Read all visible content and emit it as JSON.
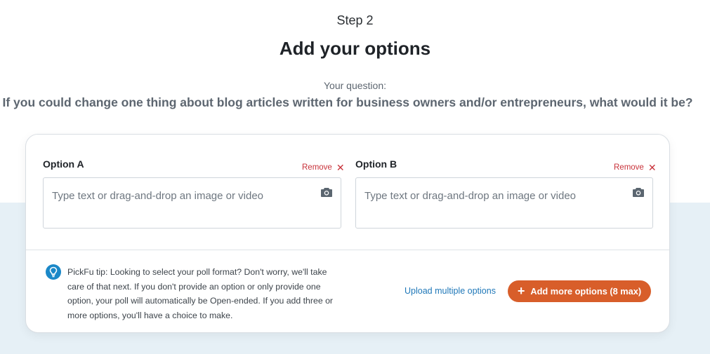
{
  "header": {
    "step": "Step 2",
    "title": "Add your options",
    "question_label": "Your question:",
    "question_text": "If you could change one thing about blog articles written for business owners and/or entrepreneurs, what would it be?"
  },
  "options": [
    {
      "label": "Option A",
      "remove_label": "Remove",
      "placeholder": "Type text or drag-and-drop an image or video"
    },
    {
      "label": "Option B",
      "remove_label": "Remove",
      "placeholder": "Type text or drag-and-drop an image or video"
    }
  ],
  "icons": {
    "remove": "close-icon",
    "upload": "camera-icon",
    "tip": "lightbulb-icon",
    "add": "plus-icon"
  },
  "tip": {
    "text": "PickFu tip: Looking to select your poll format? Don't worry, we'll take care of that next. If you don't provide an option or only provide one option, your poll will automatically be Open-ended. If you add three or more options, you'll have a choice to make."
  },
  "actions": {
    "upload_multiple": "Upload multiple options",
    "add_more": "Add more options (8 max)"
  },
  "colors": {
    "accent": "#d85e2a",
    "link": "#1e77b8",
    "remove": "#c8323a",
    "tip_icon": "#1b88c8",
    "band": "#e6f0f6"
  }
}
